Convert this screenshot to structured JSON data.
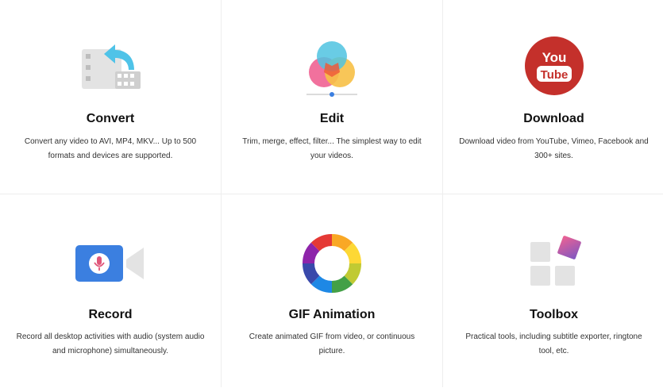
{
  "features": [
    {
      "icon": "convert-icon",
      "title": "Convert",
      "description": "Convert any video to AVI, MP4, MKV... Up to 500 formats and devices are supported."
    },
    {
      "icon": "edit-icon",
      "title": "Edit",
      "description": "Trim, merge, effect, filter... The simplest way to edit your videos."
    },
    {
      "icon": "youtube-icon",
      "title": "Download",
      "description": "Download video from YouTube, Vimeo, Facebook and 300+ sites.",
      "logo_text": {
        "top": "You",
        "bottom": "Tube"
      }
    },
    {
      "icon": "record-icon",
      "title": "Record",
      "description": "Record all desktop activities with audio (system audio and microphone) simultaneously."
    },
    {
      "icon": "gif-animation-icon",
      "title": "GIF Animation",
      "description": "Create animated GIF from video, or continuous picture."
    },
    {
      "icon": "toolbox-icon",
      "title": "Toolbox",
      "description": "Practical tools, including subtitle exporter, ringtone tool, etc."
    }
  ],
  "colors": {
    "youtube_red": "#c4302b",
    "record_blue": "#3b7fe0",
    "edit_pink": "#f06292",
    "edit_yellow": "#f7c046",
    "edit_cyan": "#4fc3e0"
  }
}
